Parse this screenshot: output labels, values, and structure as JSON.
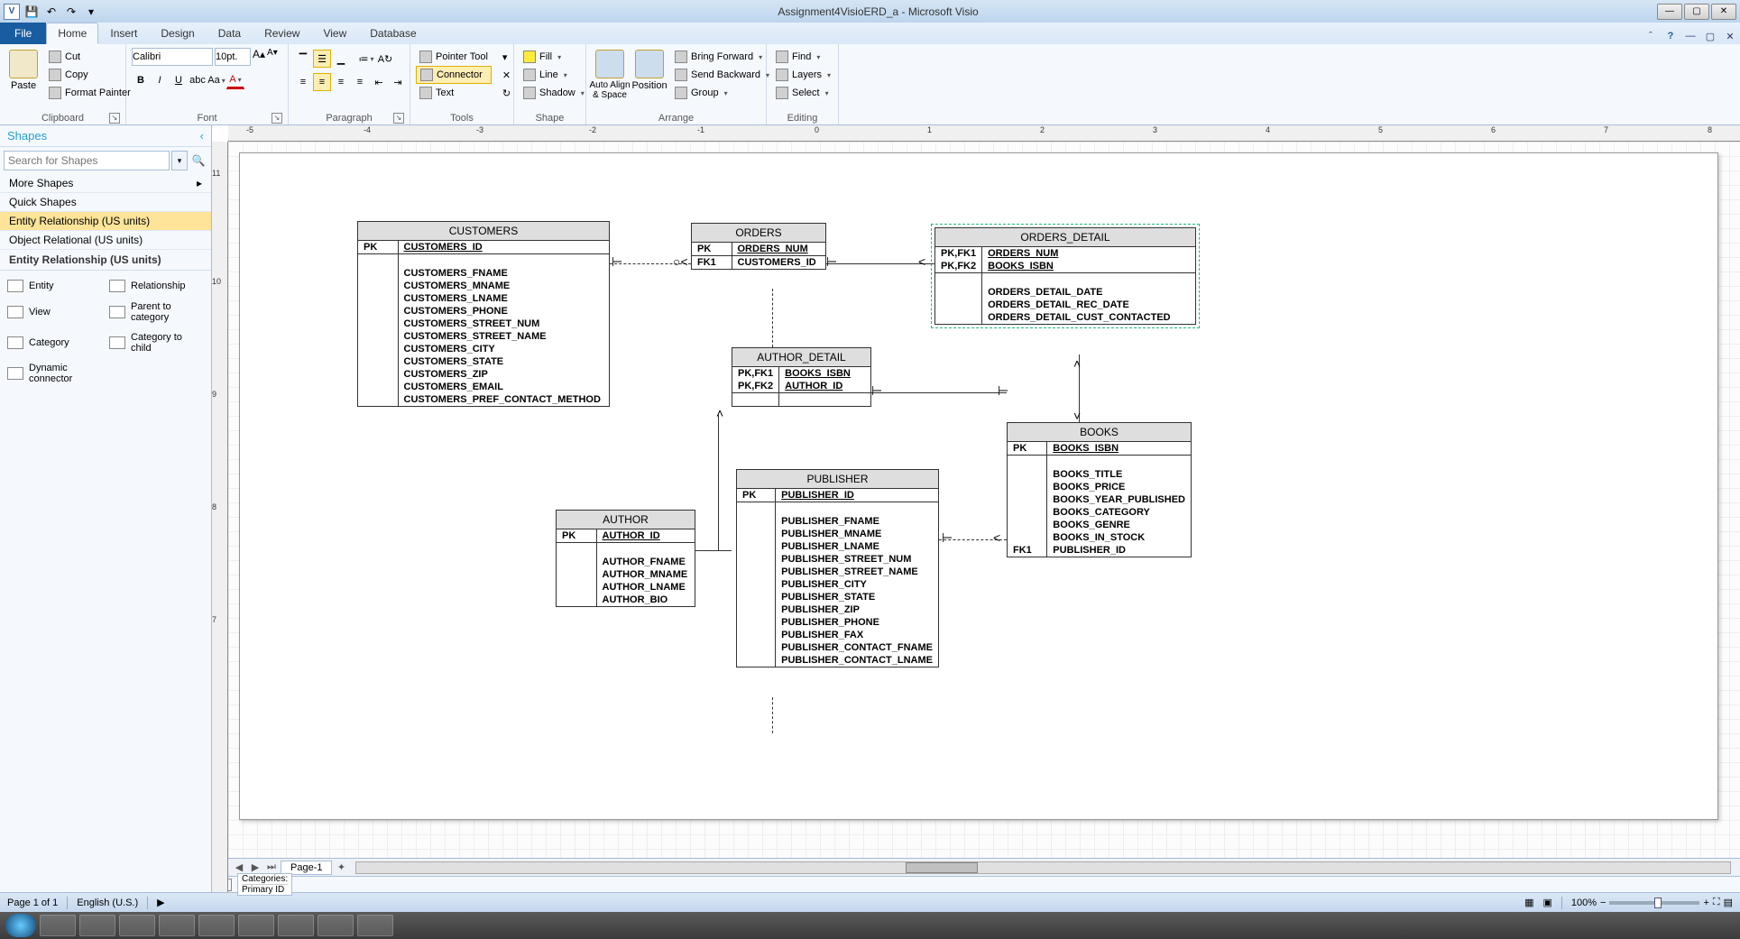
{
  "titlebar": {
    "title": "Assignment4VisioERD_a - Microsoft Visio"
  },
  "tabs": {
    "file": "File",
    "home": "Home",
    "insert": "Insert",
    "design": "Design",
    "data": "Data",
    "review": "Review",
    "view": "View",
    "database": "Database"
  },
  "ribbon": {
    "clipboard": {
      "label": "Clipboard",
      "paste": "Paste",
      "cut": "Cut",
      "copy": "Copy",
      "fmt": "Format Painter"
    },
    "font": {
      "label": "Font",
      "family": "Calibri",
      "size": "10pt."
    },
    "paragraph": {
      "label": "Paragraph"
    },
    "tools": {
      "label": "Tools",
      "pointer": "Pointer Tool",
      "connector": "Connector",
      "text": "Text"
    },
    "shape": {
      "label": "Shape",
      "fill": "Fill",
      "line": "Line",
      "shadow": "Shadow"
    },
    "arrange": {
      "label": "Arrange",
      "autoalign": "Auto Align\n& Space",
      "position": "Position",
      "fwd": "Bring Forward",
      "back": "Send Backward",
      "group": "Group"
    },
    "editing": {
      "label": "Editing",
      "find": "Find",
      "layers": "Layers",
      "select": "Select"
    }
  },
  "shapes": {
    "title": "Shapes",
    "search": "Search for Shapes",
    "more": "More Shapes",
    "quick": "Quick Shapes",
    "erus": "Entity Relationship (US units)",
    "orus": "Object Relational (US units)",
    "section": "Entity Relationship (US units)",
    "items": {
      "entity": "Entity",
      "relationship": "Relationship",
      "view": "View",
      "ptc": "Parent to category",
      "category": "Category",
      "ctc": "Category to child",
      "dyn": "Dynamic connector"
    }
  },
  "entities": {
    "customers": {
      "title": "CUSTOMERS",
      "pk": "PK",
      "pkf": "CUSTOMERS_ID",
      "attrs": [
        "CUSTOMERS_FNAME",
        "CUSTOMERS_MNAME",
        "CUSTOMERS_LNAME",
        "CUSTOMERS_PHONE",
        "CUSTOMERS_STREET_NUM",
        "CUSTOMERS_STREET_NAME",
        "CUSTOMERS_CITY",
        "CUSTOMERS_STATE",
        "CUSTOMERS_ZIP",
        "CUSTOMERS_EMAIL",
        "CUSTOMERS_PREF_CONTACT_METHOD"
      ]
    },
    "orders": {
      "title": "ORDERS",
      "pk": "PK",
      "pkf": "ORDERS_NUM",
      "fk1": "FK1",
      "fk1f": "CUSTOMERS_ID"
    },
    "orders_detail": {
      "title": "ORDERS_DETAIL",
      "pk1": "PK,FK1",
      "pk1f": "ORDERS_NUM",
      "pk2": "PK,FK2",
      "pk2f": "BOOKS_ISBN",
      "attrs": [
        "ORDERS_DETAIL_DATE",
        "ORDERS_DETAIL_REC_DATE",
        "ORDERS_DETAIL_CUST_CONTACTED"
      ]
    },
    "author_detail": {
      "title": "AUTHOR_DETAIL",
      "pk1": "PK,FK1",
      "pk1f": "BOOKS_ISBN",
      "pk2": "PK,FK2",
      "pk2f": "AUTHOR_ID"
    },
    "publisher": {
      "title": "PUBLISHER",
      "pk": "PK",
      "pkf": "PUBLISHER_ID",
      "attrs": [
        "PUBLISHER_FNAME",
        "PUBLISHER_MNAME",
        "PUBLISHER_LNAME",
        "PUBLISHER_STREET_NUM",
        "PUBLISHER_STREET_NAME",
        "PUBLISHER_CITY",
        "PUBLISHER_STATE",
        "PUBLISHER_ZIP",
        "PUBLISHER_PHONE",
        "PUBLISHER_FAX",
        "PUBLISHER_CONTACT_FNAME",
        "PUBLISHER_CONTACT_LNAME"
      ]
    },
    "author": {
      "title": "AUTHOR",
      "pk": "PK",
      "pkf": "AUTHOR_ID",
      "attrs": [
        "AUTHOR_FNAME",
        "AUTHOR_MNAME",
        "AUTHOR_LNAME",
        "AUTHOR_BIO"
      ]
    },
    "books": {
      "title": "BOOKS",
      "pk": "PK",
      "pkf": "BOOKS_ISBN",
      "fk1": "FK1",
      "attrs": [
        "BOOKS_TITLE",
        "BOOKS_PRICE",
        "BOOKS_YEAR_PUBLISHED",
        "BOOKS_CATEGORY",
        "BOOKS_GENRE",
        "BOOKS_IN_STOCK",
        "PUBLISHER_ID"
      ]
    }
  },
  "sheet": {
    "page": "Page-1"
  },
  "categories": {
    "label": "Categories:",
    "item": "Primary ID"
  },
  "status": {
    "page": "Page 1 of 1",
    "lang": "English (U.S.)",
    "zoom": "100%"
  }
}
